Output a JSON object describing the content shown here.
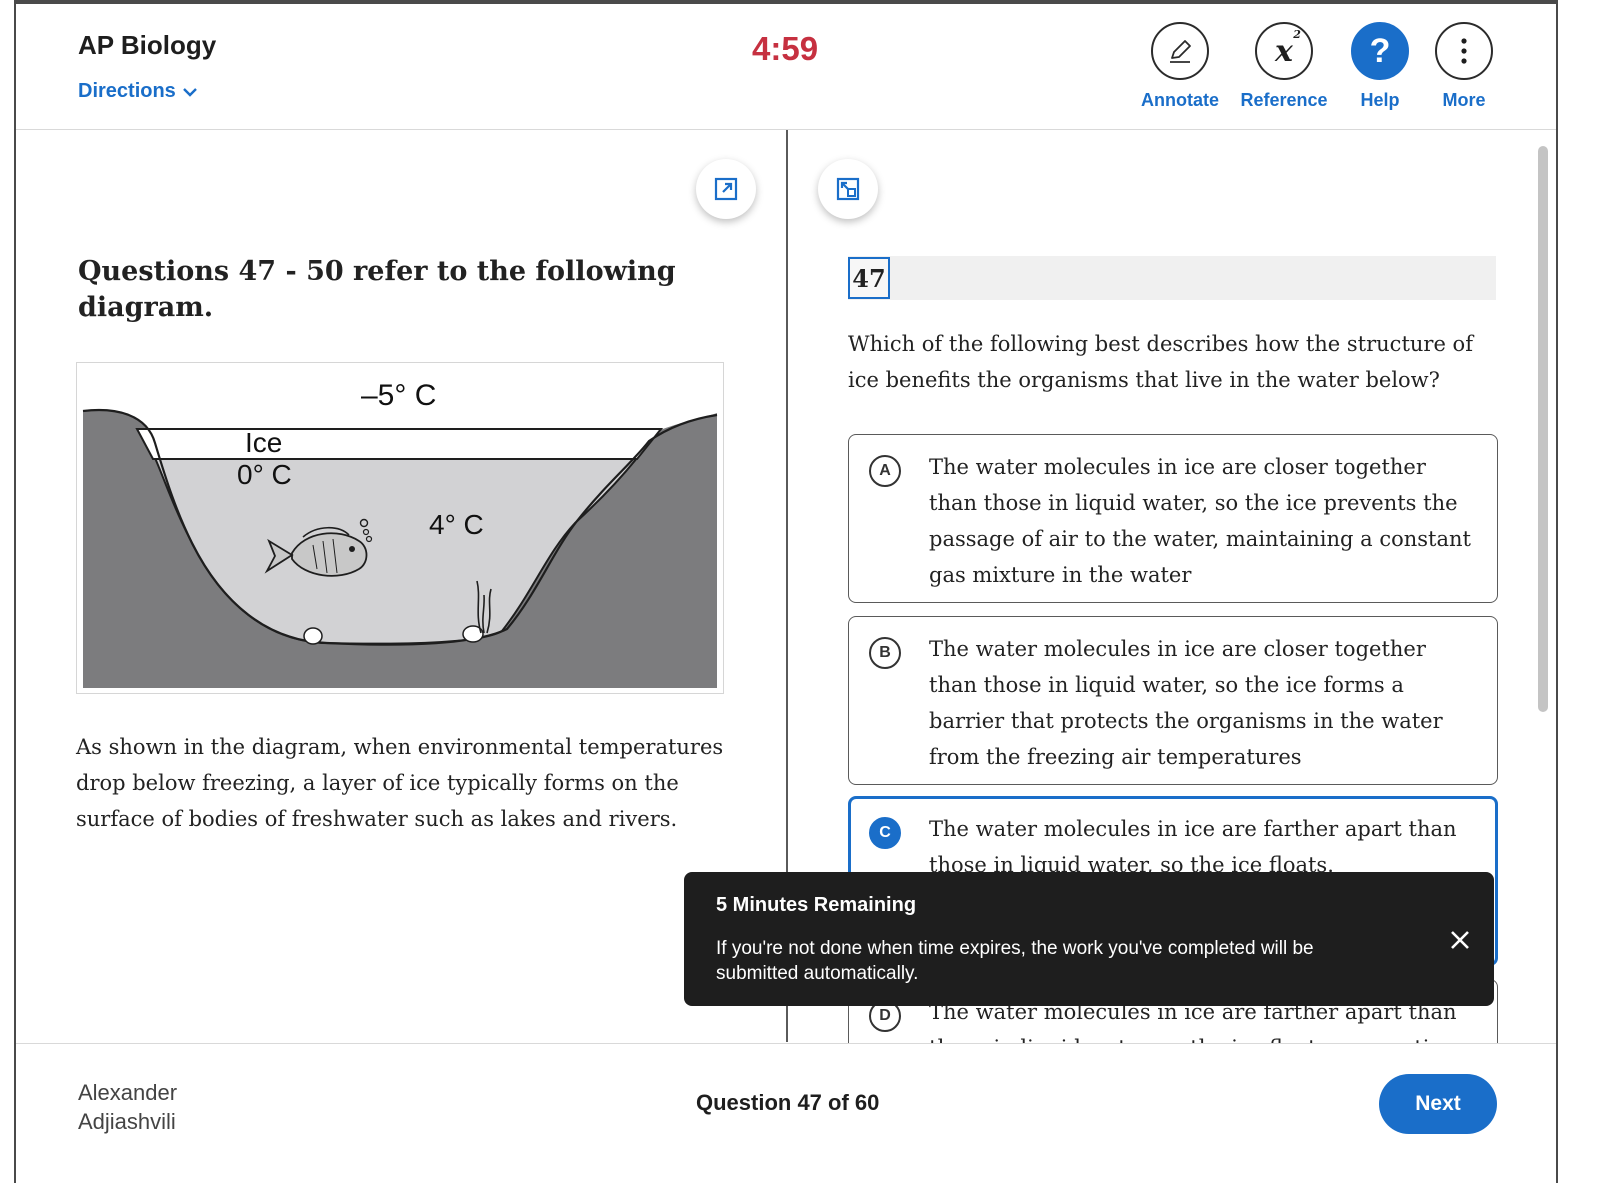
{
  "header": {
    "app_title": "AP Biology",
    "directions_label": "Directions",
    "timer": "4:59",
    "tools": [
      {
        "label": "Annotate",
        "icon": "pencil-icon"
      },
      {
        "label": "Reference",
        "icon": "formula-icon",
        "glyph": "x",
        "superscript": "2"
      },
      {
        "label": "Help",
        "icon": "help-icon",
        "glyph": "?"
      },
      {
        "label": "More",
        "icon": "more-vertical-icon"
      }
    ]
  },
  "stimulus": {
    "title": "Questions 47 - 50 refer to the following diagram.",
    "diagram": {
      "air_temp": "–5° C",
      "ice_label": "Ice",
      "ice_temp": "0° C",
      "water_temp": "4° C"
    },
    "passage": "As shown in the diagram, when environmental temperatures drop below freezing, a layer of ice typically forms on the surface of bodies of freshwater such as lakes and rivers."
  },
  "question": {
    "number": "47",
    "text": "Which of the following best describes how the structure of ice benefits the organisms that live in the water below?",
    "selected": "C",
    "choices": [
      {
        "letter": "A",
        "text": "The water molecules in ice are closer together than those in liquid water, so the ice prevents the passage of air to the water, maintaining a constant gas mixture in the water"
      },
      {
        "letter": "B",
        "text": "The water molecules in ice are closer together than those in liquid water, so the ice forms a barrier that protects the organisms in the water from the freezing air temperatures"
      },
      {
        "letter": "C",
        "text": "The water molecules in ice are farther apart than those in liquid water, so the ice floats."
      },
      {
        "letter": "D",
        "text": "The water molecules in ice are farther apart than those in liquid water, so the ice floats, preventing"
      }
    ]
  },
  "toast": {
    "title": "5 Minutes Remaining",
    "body": "If you're not done when time expires, the work you've completed will be submitted automatically."
  },
  "footer": {
    "student_name": "Alexander Adjiashvili",
    "progress": "Question 47 of 60",
    "next_label": "Next"
  },
  "colors": {
    "accent": "#1a6ec9",
    "timer": "#c63040",
    "toast_bg": "#1e1e1e"
  }
}
